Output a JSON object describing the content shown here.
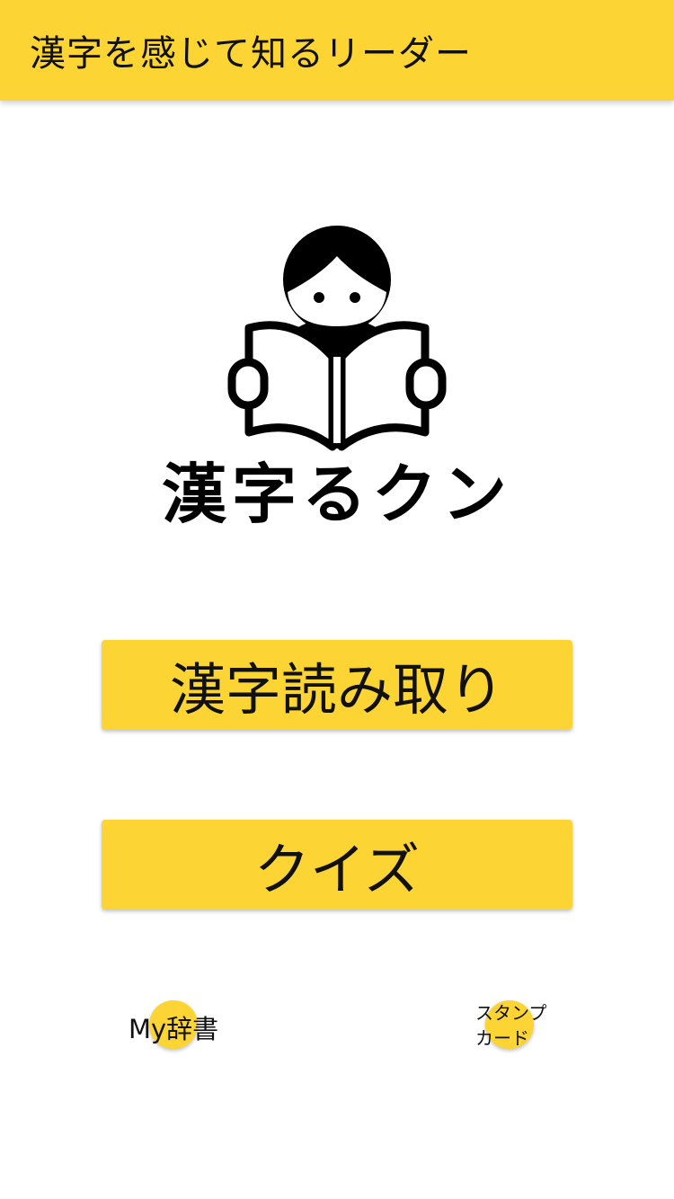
{
  "app_bar": {
    "title": "漢字を感じて知るリーダー",
    "background_color": "#FCD535"
  },
  "logo": {
    "icon": "reading-person-logo",
    "wordmark": "漢字るクン"
  },
  "buttons": {
    "read_label": "漢字読み取り",
    "quiz_label": "クイズ"
  },
  "bottom_nav": {
    "dict_label": "My辞書",
    "stamp_line1": "スタンプ",
    "stamp_line2": "カード"
  },
  "colors": {
    "accent": "#FCD535",
    "text": "#111111"
  }
}
